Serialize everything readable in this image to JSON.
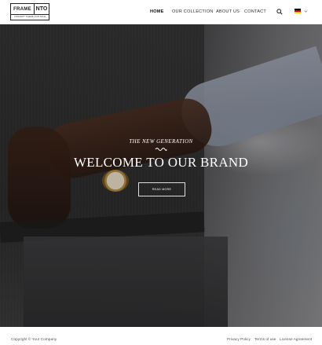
{
  "header": {
    "logo": {
      "name": "FRAME",
      "mark": "NTO",
      "tagline": "CONCEPT THEME FOR SALE"
    },
    "nav": [
      {
        "label": "HOME",
        "active": true
      },
      {
        "label": "OUR COLLECTION",
        "active": false
      },
      {
        "label": "ABOUT US",
        "active": false
      },
      {
        "label": "CONTACT",
        "active": false
      }
    ],
    "search_icon": "search-icon",
    "language": {
      "flag": "germany-flag",
      "colors": [
        "#000000",
        "#dd0000",
        "#ffce00"
      ]
    }
  },
  "hero": {
    "subtitle": "THE NEW GENERATION",
    "title": "WELCOME TO OUR BRAND",
    "button_label": "READ MORE"
  },
  "footer": {
    "copyright": "Copyright © Your Company",
    "links": [
      "Privacy Policy",
      "Terms of use",
      "License Agreement"
    ]
  }
}
